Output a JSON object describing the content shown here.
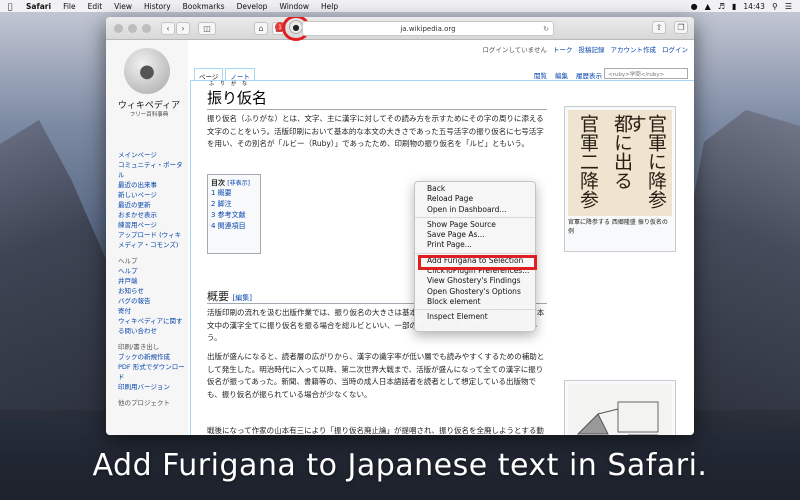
{
  "menubar": {
    "app": "Safari",
    "items": [
      "File",
      "Edit",
      "View",
      "History",
      "Bookmarks",
      "Develop",
      "Window",
      "Help"
    ],
    "time": "14:43"
  },
  "browser": {
    "url": "ja.wikipedia.org",
    "badge": "1"
  },
  "wiki": {
    "logo_title": "ウィキペディア",
    "logo_sub": "フリー百科事典",
    "top_links": [
      "ログインしていません",
      "トーク",
      "投稿記録",
      "アカウント作成",
      "ログイン"
    ],
    "tabs": [
      "ページ",
      "ノート"
    ],
    "right_tabs": [
      "閲覧",
      "編集",
      "履歴表示"
    ],
    "search_placeholder": "<ruby>学問</ruby>",
    "sidebar": [
      "メインページ",
      "コミュニティ・ポータル",
      "最近の出来事",
      "新しいページ",
      "最近の更新",
      "おまかせ表示",
      "練習用ページ",
      "アップロード (ウィキメディア・コモンズ)"
    ],
    "help_head": "ヘルプ",
    "help_links": [
      "ヘルプ",
      "井戸端",
      "お知らせ",
      "バグの報告",
      "寄付",
      "ウィキペディアに関する問い合わせ"
    ],
    "print_head": "印刷/書き出し",
    "print_links": [
      "ブックの新規作成",
      "PDF 形式でダウンロード",
      "印刷用バージョン"
    ],
    "other_head": "他のプロジェクト",
    "title": "振り仮名",
    "title_ruby": "ふりがな",
    "para1": "振り仮名（ふりがな）とは、文字、主に漢字に対してその読み方を示すためにその字の周りに添える文字のことをいう。活版印刷において基本的な本文の大きさであった五号活字の振り仮名に七号活字を用い、その別名が「ルビー（Ruby）」であったため、印刷物の振り仮名を「ルビ」ともいう。",
    "toc_title": "目次",
    "toc_toggle": "[非表示]",
    "toc_items": [
      "1 概要",
      "2 脚注",
      "3 参考文献",
      "4 関連項目"
    ],
    "h2": "概要",
    "h2_edit": "[編集]",
    "para2": "活版印刷の流れを汲む出版作業では、振り仮名の大きさは基本的に本文（親文字）の半分とする。本文中の漢字全てに振り仮名を振る場合を総ルビといい、一部の漢字のみに振る場合をパラルビという。",
    "para3": "出版が盛んになると、読者層の広がりから、漢字の識字率が低い層でも読みやすくするための補助として発生した。明治時代に入って以降、第二次世界大戦まで、活版が盛んになって全ての漢字に振り仮名が振ってあった。新聞、書籍等の、当時の成人日本語話者を読者として想定している出版物でも、振り仮名が振られている場合が少なくない。",
    "para4": "戦後になって作家の山本有三により「振り仮名廃止論」が提唱され、振り仮名を全廃しようとする動きもあった。",
    "image_caption": "官軍に降参する 西郷隆盛 振り仮名の例",
    "image_text": [
      "官軍に降参す",
      "都に出る",
      "官軍二降参"
    ]
  },
  "context_menu": {
    "items": [
      "Back",
      "Reload Page",
      "Open in Dashboard...",
      "Show Page Source",
      "Save Page As...",
      "Print Page...",
      "Add Furigana to Selection",
      "ClickToPlugin Preferences...",
      "View Ghostery's Findings",
      "Open Ghostery's Options",
      "Block element",
      "Inspect Element"
    ]
  },
  "banner": "Add Furigana to Japanese text in Safari.",
  "colors": {
    "highlight": "#e02020",
    "link": "#0645ad"
  }
}
